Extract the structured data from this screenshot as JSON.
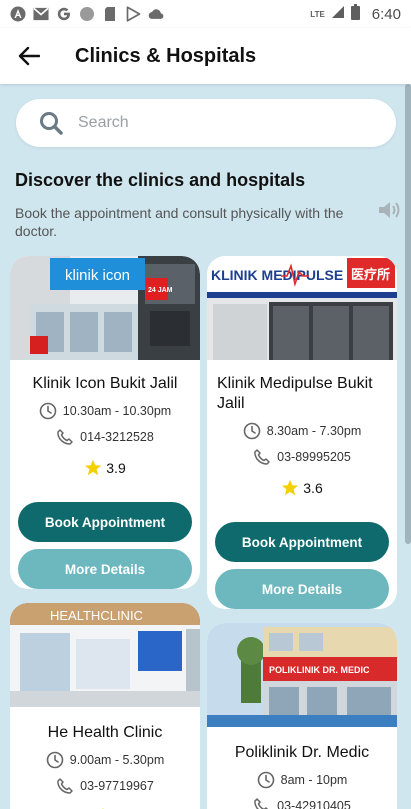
{
  "status_bar": {
    "network": "LTE",
    "time": "6:40",
    "left_icons": [
      "angular-icon",
      "gmail-icon",
      "google-icon",
      "circle-icon",
      "sim-icon",
      "play-store-icon",
      "cloud-icon"
    ]
  },
  "app_bar": {
    "title": "Clinics & Hospitals"
  },
  "search": {
    "placeholder": "Search",
    "value": ""
  },
  "section": {
    "title": "Discover the clinics and hospitals",
    "description": "Book the appointment and consult physically with the doctor."
  },
  "cards": [
    {
      "name": "Klinik Icon Bukit Jalil",
      "hours": "10.30am - 10.30pm",
      "phone": "014-3212528",
      "rating": "3.9",
      "book_label": "Book Appointment",
      "more_label": "More Details",
      "sign_text": "klinik icon",
      "badge_text": "24 JAM"
    },
    {
      "name": "Klinik Medipulse Bukit Jalil",
      "hours": "8.30am - 7.30pm",
      "phone": "03-89995205",
      "rating": "3.6",
      "book_label": "Book Appointment",
      "more_label": "More Details",
      "sign_text": "KLINIK MEDIPULSE",
      "sign_chinese": "医疗所"
    },
    {
      "name": "He Health Clinic",
      "hours": "9.00am - 5.30pm",
      "phone": "03-97719967",
      "rating": "",
      "sign_text": "HEALTHCLINIC"
    },
    {
      "name": "Poliklinik Dr. Medic",
      "hours": "8am - 10pm",
      "phone": "03-42910405",
      "rating": "",
      "sign_text": "POLIKLINIK DR. MEDIC"
    }
  ],
  "colors": {
    "background": "#cfe6ef",
    "primary_button": "#0e6a6c",
    "secondary_button": "#6cb8be",
    "star": "#f5d000"
  }
}
